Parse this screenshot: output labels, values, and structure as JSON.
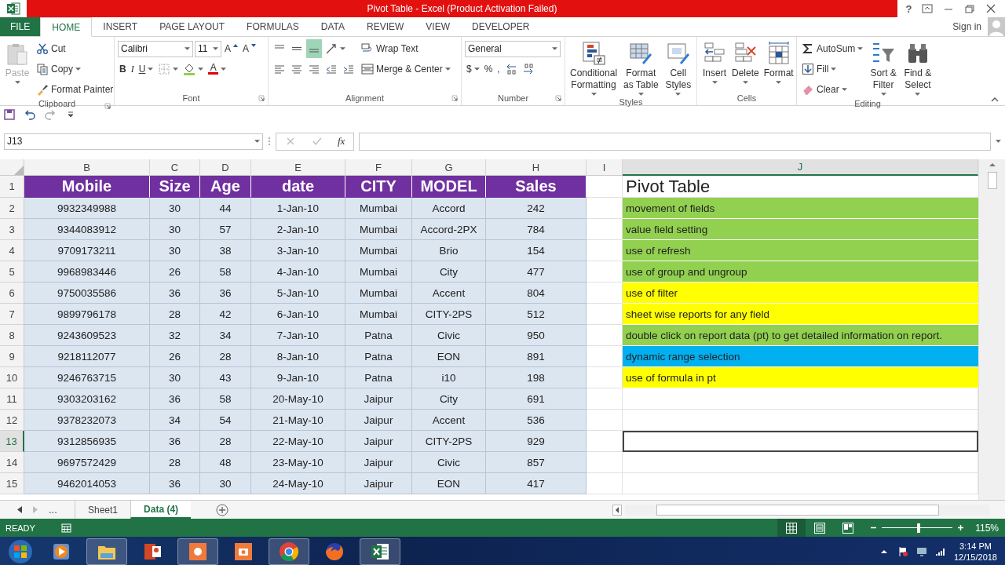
{
  "window": {
    "title": "Pivot Table - Excel (Product Activation Failed)",
    "help": "?",
    "sign_in": "Sign in"
  },
  "ribbon_tabs": [
    {
      "label": "FILE",
      "kind": "file",
      "selected": false
    },
    {
      "label": "HOME",
      "kind": "tab",
      "selected": true
    },
    {
      "label": "INSERT",
      "kind": "tab",
      "selected": false
    },
    {
      "label": "PAGE LAYOUT",
      "kind": "tab",
      "selected": false
    },
    {
      "label": "FORMULAS",
      "kind": "tab",
      "selected": false
    },
    {
      "label": "DATA",
      "kind": "tab",
      "selected": false
    },
    {
      "label": "REVIEW",
      "kind": "tab",
      "selected": false
    },
    {
      "label": "VIEW",
      "kind": "tab",
      "selected": false
    },
    {
      "label": "DEVELOPER",
      "kind": "tab",
      "selected": false
    }
  ],
  "ribbon_groups": [
    {
      "label": "Clipboard",
      "launcher": true,
      "items": [
        {
          "label": "Paste",
          "disabled": true
        },
        {
          "label": "Cut"
        },
        {
          "label": "Copy"
        },
        {
          "label": "Format Painter"
        }
      ]
    },
    {
      "label": "Font",
      "launcher": true,
      "items": [
        {
          "value": "Calibri"
        },
        {
          "value": "11"
        },
        {
          "label": "A"
        },
        {
          "label": "A"
        },
        {
          "label": "B"
        },
        {
          "label": "I"
        },
        {
          "label": "U"
        },
        {
          "label": "A"
        }
      ]
    },
    {
      "label": "Alignment",
      "launcher": true,
      "items": [
        {
          "selected": false
        },
        {
          "selected": false
        },
        {
          "selected": true
        },
        {
          "label": "Wrap Text"
        },
        {
          "label": "Merge & Center"
        }
      ]
    },
    {
      "label": "Number",
      "launcher": true,
      "items": [
        {
          "value": "General"
        },
        {
          "label": "$"
        },
        {
          "label": "%"
        },
        {
          "label": ","
        }
      ]
    },
    {
      "label": "Styles",
      "launcher": false,
      "items": [
        {
          "label": "Conditional Formatting"
        },
        {
          "label": "Format as Table"
        },
        {
          "label": "Cell Styles"
        }
      ]
    },
    {
      "label": "Cells",
      "launcher": false,
      "items": [
        {
          "label": "Insert"
        },
        {
          "label": "Delete"
        },
        {
          "label": "Format"
        }
      ]
    },
    {
      "label": "Editing",
      "launcher": false,
      "items": [
        {
          "label": "AutoSum"
        },
        {
          "label": "Fill"
        },
        {
          "label": "Clear"
        },
        {
          "label": "Sort & Filter"
        },
        {
          "label": "Find & Select"
        }
      ]
    }
  ],
  "formula_bar": {
    "name_box": "J13",
    "function_label": "fx"
  },
  "columns": [
    {
      "label": "B",
      "selected": false
    },
    {
      "label": "C",
      "selected": false
    },
    {
      "label": "D",
      "selected": false
    },
    {
      "label": "E",
      "selected": false
    },
    {
      "label": "F",
      "selected": false
    },
    {
      "label": "G",
      "selected": false
    },
    {
      "label": "H",
      "selected": false
    },
    {
      "label": "I",
      "selected": false
    },
    {
      "label": "J",
      "selected": true
    }
  ],
  "rows": [
    {
      "number": "1",
      "kind": "header",
      "selected": false,
      "cells": [
        "Mobile",
        "Size",
        "Age",
        "date",
        "CITY",
        "MODEL",
        "Sales"
      ],
      "title": "Pivot Table"
    },
    {
      "number": "2",
      "kind": "data",
      "selected": false,
      "cells": [
        "9932349988",
        "30",
        "44",
        "1-Jan-10",
        "Mumbai",
        "Accord",
        "242"
      ],
      "note": {
        "text": "movement of fields",
        "color": "#92d050"
      }
    },
    {
      "number": "3",
      "kind": "data",
      "selected": false,
      "cells": [
        "9344083912",
        "30",
        "57",
        "2-Jan-10",
        "Mumbai",
        "Accord-2PX",
        "784"
      ],
      "note": {
        "text": "value field setting",
        "color": "#92d050"
      }
    },
    {
      "number": "4",
      "kind": "data",
      "selected": false,
      "cells": [
        "9709173211",
        "30",
        "38",
        "3-Jan-10",
        "Mumbai",
        "Brio",
        "154"
      ],
      "note": {
        "text": "use of refresh",
        "color": "#92d050"
      }
    },
    {
      "number": "5",
      "kind": "data",
      "selected": false,
      "cells": [
        "9968983446",
        "26",
        "58",
        "4-Jan-10",
        "Mumbai",
        "City",
        "477"
      ],
      "note": {
        "text": "use of group and ungroup",
        "color": "#92d050"
      }
    },
    {
      "number": "6",
      "kind": "data",
      "selected": false,
      "cells": [
        "9750035586",
        "36",
        "36",
        "5-Jan-10",
        "Mumbai",
        "Accent",
        "804"
      ],
      "note": {
        "text": "use of filter",
        "color": "#ffff00"
      }
    },
    {
      "number": "7",
      "kind": "data",
      "selected": false,
      "cells": [
        "9899796178",
        "28",
        "42",
        "6-Jan-10",
        "Mumbai",
        "CITY-2PS",
        "512"
      ],
      "note": {
        "text": "sheet wise reports for any field",
        "color": "#ffff00"
      }
    },
    {
      "number": "8",
      "kind": "data",
      "selected": false,
      "cells": [
        "9243609523",
        "32",
        "34",
        "7-Jan-10",
        "Patna",
        "Civic",
        "950"
      ],
      "note": {
        "text": "double click on report data (pt) to get detailed information on report.",
        "color": "#92d050"
      }
    },
    {
      "number": "9",
      "kind": "data",
      "selected": false,
      "cells": [
        "9218112077",
        "26",
        "28",
        "8-Jan-10",
        "Patna",
        "EON",
        "891"
      ],
      "note": {
        "text": "dynamic range selection",
        "color": "#00b0f0"
      }
    },
    {
      "number": "10",
      "kind": "data",
      "selected": false,
      "cells": [
        "9246763715",
        "30",
        "43",
        "9-Jan-10",
        "Patna",
        "i10",
        "198"
      ],
      "note": {
        "text": "use of formula in pt",
        "color": "#ffff00"
      }
    },
    {
      "number": "11",
      "kind": "data",
      "selected": false,
      "cells": [
        "9303203162",
        "36",
        "58",
        "20-May-10",
        "Jaipur",
        "City",
        "691"
      ]
    },
    {
      "number": "12",
      "kind": "data",
      "selected": false,
      "cells": [
        "9378232073",
        "34",
        "54",
        "21-May-10",
        "Jaipur",
        "Accent",
        "536"
      ]
    },
    {
      "number": "13",
      "kind": "data",
      "selected": true,
      "cells": [
        "9312856935",
        "36",
        "28",
        "22-May-10",
        "Jaipur",
        "CITY-2PS",
        "929"
      ]
    },
    {
      "number": "14",
      "kind": "data",
      "selected": false,
      "cells": [
        "9697572429",
        "28",
        "48",
        "23-May-10",
        "Jaipur",
        "Civic",
        "857"
      ]
    },
    {
      "number": "15",
      "kind": "data",
      "selected": false,
      "cells": [
        "9462014053",
        "36",
        "30",
        "24-May-10",
        "Jaipur",
        "EON",
        "417"
      ]
    }
  ],
  "sheet_tabs": {
    "more": "...",
    "tabs": [
      {
        "label": "Sheet1",
        "selected": false
      },
      {
        "label": "Data (4)",
        "selected": true
      }
    ]
  },
  "status_bar": {
    "mode": "READY",
    "views": [
      {
        "kind": "normal",
        "selected": true
      },
      {
        "kind": "page_layout",
        "selected": false
      },
      {
        "kind": "page_break",
        "selected": false
      }
    ],
    "zoom": {
      "level": 0.52,
      "reading": "115%"
    }
  },
  "taskbar": {
    "apps": [
      {
        "kind": "media",
        "open": false
      },
      {
        "kind": "folder",
        "open": true
      },
      {
        "kind": "slides",
        "open": false
      },
      {
        "kind": "capture",
        "open": true
      },
      {
        "kind": "camera",
        "open": false
      },
      {
        "kind": "chrome",
        "open": true
      },
      {
        "kind": "firefox",
        "open": false
      },
      {
        "kind": "sheet",
        "open": true
      }
    ],
    "time": "3:14 PM",
    "date": "12/15/2018"
  }
}
